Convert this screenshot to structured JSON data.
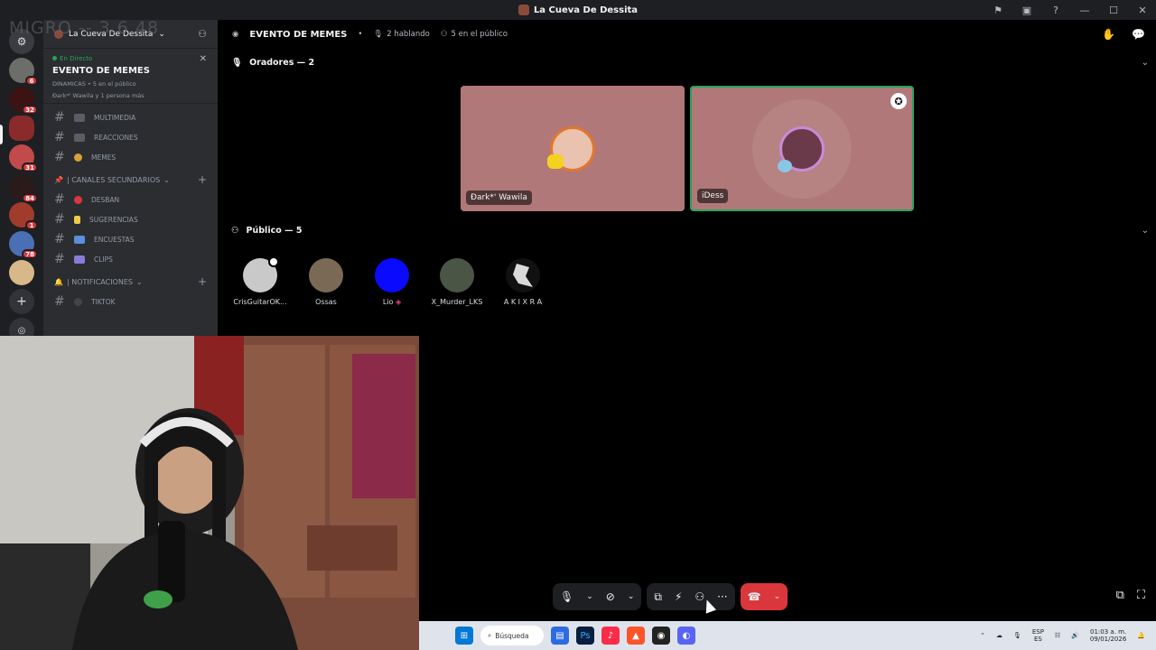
{
  "window": {
    "title": "La Cueva De Dessita"
  },
  "server_rail": {
    "badges": [
      "6",
      "32",
      "31",
      "84",
      "1",
      "78"
    ]
  },
  "sidebar": {
    "ghost_text": "MIGRO -- 3.6 48",
    "server_name": "La Cueva De Dessita",
    "live": {
      "label": "En Directo",
      "event_title": "EVENTO DE MEMES",
      "meta_line": "DINAMICAS • 5 en el público",
      "participants_line": "Ðark*' Wawila y 1 persona más"
    },
    "channels_top": [
      "MULTIMEDIA",
      "REACCIONES",
      "MEMES"
    ],
    "category_secondary": "| CANALES SECUNDARIOS",
    "channels_secondary": [
      "DESBAN",
      "SUGERENCIAS",
      "ENCUESTAS",
      "CLIPS"
    ],
    "category_notifications": "| NOTIFICACIONES",
    "channels_notifications": [
      "TIKTOK"
    ]
  },
  "stage": {
    "event_name": "EVENTO DE MEMES",
    "speaking": "2 hablando",
    "audience_count": "5 en el público",
    "speakers_header": "Oradores — 2",
    "speakers": [
      {
        "name": "Ðark*' Wawila",
        "color": "#b07878"
      },
      {
        "name": "iDess",
        "color": "#a97373"
      }
    ],
    "audience_header": "Público — 5",
    "audience": [
      {
        "name": "CrisGuitarOK...",
        "color": "#c9c9c9"
      },
      {
        "name": "Ossas",
        "color": "#7a6a55"
      },
      {
        "name": "Lio",
        "color": "#0a0aff"
      },
      {
        "name": "X_Murder_LKS",
        "color": "#4a5546"
      },
      {
        "name": "A K I X R A",
        "color": "#111111"
      }
    ]
  },
  "taskbar": {
    "search_label": "Búsqueda",
    "lang_top": "ESP",
    "lang_bottom": "ES",
    "time": "01:03 a. m.",
    "date": "09/01/2026"
  },
  "colors": {
    "accent_live": "#23a55a",
    "hangup": "#da373c",
    "badge": "#da373c"
  }
}
